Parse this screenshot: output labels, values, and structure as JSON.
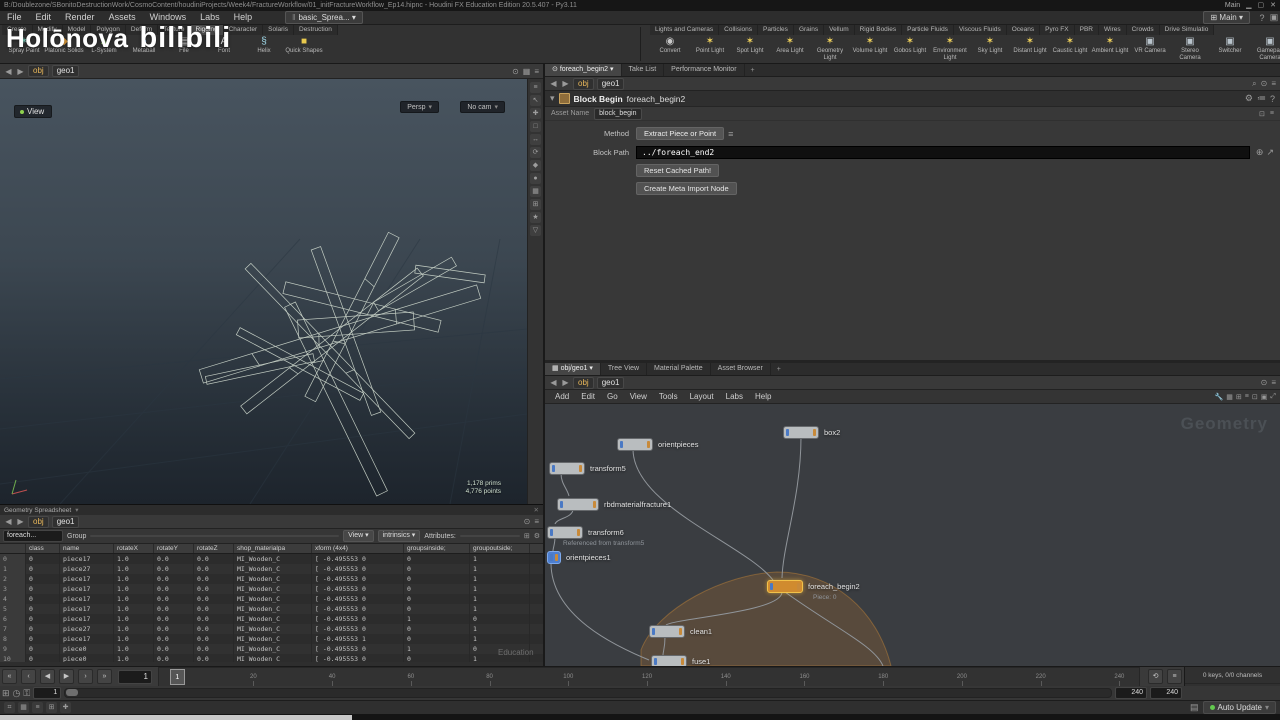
{
  "titlebar": {
    "title": "B:/Doublezone/SBonitoDestructionWork/CosmoContent/houdiniProjects/Week4/FractureWorkflow/01_initFractureWorkflow_Ep14.hipnc - Houdini FX Education Edition 20.5.407 - Py3.11",
    "right_label": "Main"
  },
  "menubar": {
    "items": [
      "File",
      "Edit",
      "Render",
      "Assets",
      "Windows",
      "Labs",
      "Help"
    ],
    "desktop_tab": "basic_Sprea...",
    "layout_selector": "Main"
  },
  "watermark": {
    "brand": "Holōnova",
    "site": "bilibili"
  },
  "shelf": {
    "left_tabs": [
      "Create",
      "Modify",
      "Model",
      "Polygon",
      "Deform",
      "Texture",
      "Rigging",
      "Character",
      "Solaris",
      "Destruction"
    ],
    "left_tools": [
      {
        "label": "Spray Paint",
        "glyph": "✶",
        "color": "#7fd4c1"
      },
      {
        "label": "Platonic Solids",
        "glyph": "◆",
        "color": "#e8a33d"
      },
      {
        "label": "L-System",
        "glyph": "▲",
        "color": "#8fc866"
      },
      {
        "label": "Metaball",
        "glyph": "●",
        "color": "#6fa8dc"
      },
      {
        "label": "File",
        "glyph": "▤",
        "color": "#c9c9c9"
      },
      {
        "label": "Font",
        "glyph": "A",
        "color": "#e0e0e0"
      },
      {
        "label": "Helix",
        "glyph": "§",
        "color": "#9fd8e8"
      },
      {
        "label": "Quick Shapes",
        "glyph": "■",
        "color": "#e8c94d"
      }
    ],
    "right_tabs": [
      "Lights and Cameras",
      "Collisions",
      "Particles",
      "Grains",
      "Vellum",
      "Rigid Bodies",
      "Particle Fluids",
      "Viscous Fluids",
      "Oceans",
      "Pyro FX",
      "PBR",
      "Wires",
      "Crowds",
      "Drive Simulatio"
    ],
    "right_tools": [
      {
        "label": "Convert",
        "glyph": "◉",
        "color": "#c9c9c9"
      },
      {
        "label": "Point Light",
        "glyph": "✶",
        "color": "#f2d35c"
      },
      {
        "label": "Spot Light",
        "glyph": "✶",
        "color": "#f2d35c"
      },
      {
        "label": "Area Light",
        "glyph": "✶",
        "color": "#f2d35c"
      },
      {
        "label": "Geometry Light",
        "glyph": "✶",
        "color": "#f2d35c"
      },
      {
        "label": "Volume Light",
        "glyph": "✶",
        "color": "#f2d35c"
      },
      {
        "label": "Gobos Light",
        "glyph": "✶",
        "color": "#f2d35c"
      },
      {
        "label": "Environment Light",
        "glyph": "✶",
        "color": "#f2d35c"
      },
      {
        "label": "Sky Light",
        "glyph": "✶",
        "color": "#f2d35c"
      },
      {
        "label": "Distant Light",
        "glyph": "✶",
        "color": "#f2d35c"
      },
      {
        "label": "Caustic Light",
        "glyph": "✶",
        "color": "#f2d35c"
      },
      {
        "label": "Ambient Light",
        "glyph": "✶",
        "color": "#f2d35c"
      },
      {
        "label": "VR Camera",
        "glyph": "▣",
        "color": "#b9c4cc"
      },
      {
        "label": "Stereo Camera",
        "glyph": "▣",
        "color": "#b9c4cc"
      },
      {
        "label": "Switcher",
        "glyph": "▣",
        "color": "#b9c4cc"
      },
      {
        "label": "Gamepad Camera",
        "glyph": "▣",
        "color": "#b9c4cc"
      }
    ]
  },
  "viewport": {
    "path": {
      "context": "obj",
      "node": "geo1"
    },
    "view_tab": "View",
    "persp_label": "Persp",
    "cam_label": "No cam",
    "stats": {
      "prims": "1,178 prims",
      "points": "4,776 points"
    },
    "tools": [
      "≡",
      "↖",
      "✚",
      "□",
      "↔",
      "⟳",
      "◆",
      "●",
      "▦",
      "⊞",
      "★",
      "▽"
    ]
  },
  "params": {
    "tabs": [
      "foreach_begin2",
      "Take List",
      "Performance Monitor"
    ],
    "path": {
      "context": "obj",
      "node": "geo1"
    },
    "node_type": "Block Begin",
    "node_name": "foreach_begin2",
    "asset_label": "Asset Name",
    "asset_value": "block_begin",
    "method_label": "Method",
    "method_value": "Extract Piece or Point",
    "block_path_label": "Block Path",
    "block_path_value": "../foreach_end2",
    "buttons": [
      "Reset Cached Path!",
      "Create Meta Import Node"
    ]
  },
  "network": {
    "tabs": [
      "obj/geo1",
      "Tree View",
      "Material Palette",
      "Asset Browser"
    ],
    "path": {
      "context": "obj",
      "node": "geo1"
    },
    "menu": [
      "Add",
      "Edit",
      "Go",
      "View",
      "Tools",
      "Layout",
      "Labs",
      "Help"
    ],
    "watermark": "Geometry",
    "nodes": [
      {
        "label": "box2"
      },
      {
        "label": "orientpieces"
      },
      {
        "label": "transform5"
      },
      {
        "label": "rbdmaterialfracture1"
      },
      {
        "label": "transform6",
        "note": "Referenced from transform5"
      },
      {
        "label": "orientpieces1"
      },
      {
        "label": "foreach_begin2",
        "badge": "Piece: 0"
      },
      {
        "label": "clean1"
      },
      {
        "label": "fuse1"
      }
    ]
  },
  "spreadsheet": {
    "panel_tab": "Geometry Spreadsheet",
    "path": {
      "context": "obj",
      "node": "geo1"
    },
    "toolbar": {
      "node_value": "foreach...",
      "group_label": "Group",
      "view_label": "View",
      "intrinsics_label": "intrinsics",
      "attributes_label": "Attributes:"
    },
    "columns": [
      "",
      "class",
      "name",
      "rotateX",
      "rotateY",
      "rotateZ",
      "shop_materialpa",
      "xform (4x4)",
      "groupsinside;",
      "groupoutside;"
    ],
    "rows": [
      [
        "0",
        "0",
        "piece17",
        "1.0",
        "0.0",
        "0.0",
        "MI_Wooden_C",
        "[ -0.495553 0",
        "0",
        "1"
      ],
      [
        "1",
        "0",
        "piece27",
        "1.0",
        "0.0",
        "0.0",
        "MI_Wooden_C",
        "[ -0.495553 0",
        "0",
        "1"
      ],
      [
        "2",
        "0",
        "piece17",
        "1.0",
        "0.0",
        "0.0",
        "MI_Wooden_C",
        "[ -0.495553 0",
        "0",
        "1"
      ],
      [
        "3",
        "0",
        "piece17",
        "1.0",
        "0.0",
        "0.0",
        "MI_Wooden_C",
        "[ -0.495553 0",
        "0",
        "1"
      ],
      [
        "4",
        "0",
        "piece17",
        "1.0",
        "0.0",
        "0.0",
        "MI_Wooden_C",
        "[ -0.495553 0",
        "0",
        "1"
      ],
      [
        "5",
        "0",
        "piece17",
        "1.0",
        "0.0",
        "0.0",
        "MI_Wooden_C",
        "[ -0.495553 0",
        "0",
        "1"
      ],
      [
        "6",
        "0",
        "piece17",
        "1.0",
        "0.0",
        "0.0",
        "MI_Wooden_C",
        "[ -0.495553 0",
        "1",
        "0"
      ],
      [
        "7",
        "0",
        "piece27",
        "1.0",
        "0.0",
        "0.0",
        "MI_Wooden_C",
        "[ -0.495553 0",
        "0",
        "1"
      ],
      [
        "8",
        "0",
        "piece17",
        "1.0",
        "0.0",
        "0.0",
        "MI_Wooden_C",
        "[ -0.495553 1",
        "0",
        "1"
      ],
      [
        "9",
        "0",
        "piece0",
        "1.0",
        "0.0",
        "0.0",
        "MI_Wooden_C",
        "[ -0.495553 0",
        "1",
        "0"
      ],
      [
        "10",
        "0",
        "piece0",
        "1.0",
        "0.0",
        "0.0",
        "MI_Wooden_C",
        "[ -0.495553 0",
        "0",
        "1"
      ]
    ],
    "edition_watermark": "Education"
  },
  "playbar": {
    "frame": "1",
    "range": [
      1,
      240
    ],
    "ticks": [
      20,
      40,
      60,
      80,
      100,
      120,
      140,
      160,
      180,
      200,
      220,
      240
    ],
    "range_start": "1",
    "range_end": "240",
    "range_max": "240",
    "keys_info": "0 keys, 0/0 channels",
    "key_button": "Key All Channels"
  },
  "statusbar": {
    "icons": [
      "⌗",
      "▦",
      "≡",
      "⊞",
      "✚"
    ],
    "auto_update": "Auto Update"
  }
}
